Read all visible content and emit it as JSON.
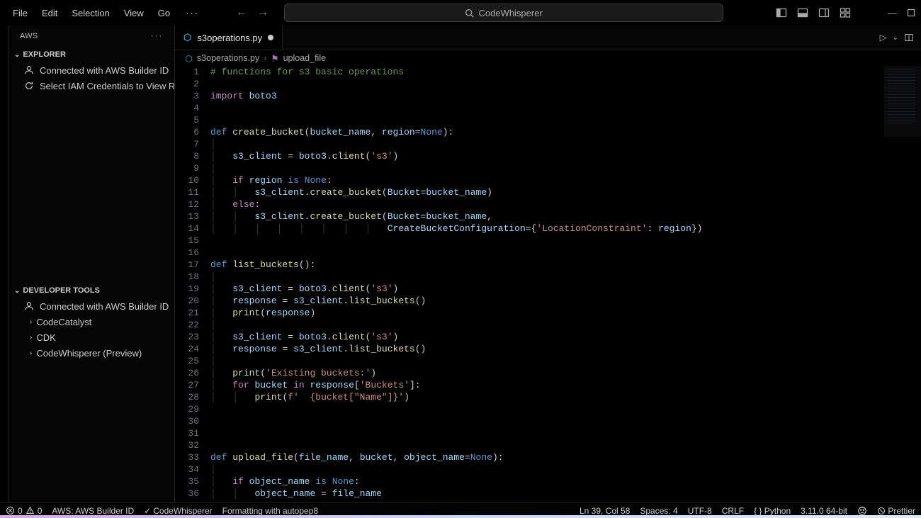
{
  "menu": {
    "items": [
      "File",
      "Edit",
      "Selection",
      "View",
      "Go"
    ],
    "overflow": "···"
  },
  "search": {
    "text": "CodeWhisperer"
  },
  "sidebar": {
    "title": "AWS",
    "explorer": {
      "header": "EXPLORER",
      "items": [
        {
          "label": "Connected with AWS Builder ID",
          "icon": "user"
        },
        {
          "label": "Select IAM Credentials to View Reso…",
          "icon": "refresh"
        }
      ]
    },
    "devtools": {
      "header": "DEVELOPER TOOLS",
      "connected": {
        "label": "Connected with AWS Builder ID",
        "icon": "user"
      },
      "tree": [
        {
          "label": "CodeCatalyst"
        },
        {
          "label": "CDK"
        },
        {
          "label": "CodeWhisperer (Preview)"
        }
      ]
    }
  },
  "tab": {
    "name": "s3operations.py"
  },
  "breadcrumb": {
    "file": "s3operations.py",
    "symbol": "upload_file"
  },
  "code": {
    "lines": [
      {
        "n": 1,
        "html": "<span class='c'># functions for s3 basic operations</span>"
      },
      {
        "n": 2,
        "html": ""
      },
      {
        "n": 3,
        "html": "<span class='k'>import</span> <span class='v'>boto3</span>"
      },
      {
        "n": 4,
        "html": ""
      },
      {
        "n": 5,
        "html": ""
      },
      {
        "n": 6,
        "html": "<span class='kb'>def</span> <span class='fn'>create_bucket</span>(<span class='v'>bucket_name</span>, <span class='v'>region</span><span class='op'>=</span><span class='kb'>None</span>):"
      },
      {
        "n": 7,
        "html": "<span class='ig'>│</span>"
      },
      {
        "n": 8,
        "html": "<span class='ig'>│</span>   <span class='v'>s3_client</span> <span class='op'>=</span> <span class='v'>boto3</span>.<span class='fn'>client</span>(<span class='s'>'s3'</span>)"
      },
      {
        "n": 9,
        "html": "<span class='ig'>│</span>"
      },
      {
        "n": 10,
        "html": "<span class='ig'>│</span>   <span class='k'>if</span> <span class='v'>region</span> <span class='kb'>is</span> <span class='kb'>None</span>:"
      },
      {
        "n": 11,
        "html": "<span class='ig'>│</span>   <span class='ig'>│</span>   <span class='v'>s3_client</span>.<span class='fn'>create_bucket</span>(<span class='v'>Bucket</span><span class='op'>=</span><span class='v'>bucket_name</span>)"
      },
      {
        "n": 12,
        "html": "<span class='ig'>│</span>   <span class='k'>else</span>:"
      },
      {
        "n": 13,
        "html": "<span class='ig'>│</span>   <span class='ig'>│</span>   <span class='v'>s3_client</span>.<span class='fn'>create_bucket</span>(<span class='v'>Bucket</span><span class='op'>=</span><span class='v'>bucket_name</span>,"
      },
      {
        "n": 14,
        "html": "<span class='ig'>│</span>   <span class='ig'>│</span>   <span class='ig'>│</span>   <span class='ig'>│</span>   <span class='ig'>│</span>   <span class='ig'>│</span>   <span class='ig'>│</span>   <span class='ig'>│</span>   <span class='v'>CreateBucketConfiguration</span><span class='op'>=</span>{<span class='s'>'LocationConstraint'</span>: <span class='v'>region</span>})"
      },
      {
        "n": 15,
        "html": ""
      },
      {
        "n": 16,
        "html": ""
      },
      {
        "n": 17,
        "html": "<span class='kb'>def</span> <span class='fn'>list_buckets</span>():"
      },
      {
        "n": 18,
        "html": "<span class='ig'>│</span>"
      },
      {
        "n": 19,
        "html": "<span class='ig'>│</span>   <span class='v'>s3_client</span> <span class='op'>=</span> <span class='v'>boto3</span>.<span class='fn'>client</span>(<span class='s'>'s3'</span>)"
      },
      {
        "n": 20,
        "html": "<span class='ig'>│</span>   <span class='v'>response</span> <span class='op'>=</span> <span class='v'>s3_client</span>.<span class='fn'>list_buckets</span>()"
      },
      {
        "n": 21,
        "html": "<span class='ig'>│</span>   <span class='fn'>print</span>(<span class='v'>response</span>)"
      },
      {
        "n": 22,
        "html": "<span class='ig'>│</span>"
      },
      {
        "n": 23,
        "html": "<span class='ig'>│</span>   <span class='v'>s3_client</span> <span class='op'>=</span> <span class='v'>boto3</span>.<span class='fn'>client</span>(<span class='s'>'s3'</span>)"
      },
      {
        "n": 24,
        "html": "<span class='ig'>│</span>   <span class='v'>response</span> <span class='op'>=</span> <span class='v'>s3_client</span>.<span class='fn'>list_buckets</span>()"
      },
      {
        "n": 25,
        "html": "<span class='ig'>│</span>"
      },
      {
        "n": 26,
        "html": "<span class='ig'>│</span>   <span class='fn'>print</span>(<span class='s'>'Existing buckets:'</span>)"
      },
      {
        "n": 27,
        "html": "<span class='ig'>│</span>   <span class='k'>for</span> <span class='v'>bucket</span> <span class='k'>in</span> <span class='v'>response</span>[<span class='s'>'Buckets'</span>]:"
      },
      {
        "n": 28,
        "html": "<span class='ig'>│</span>   <span class='ig'>│</span>   <span class='fn'>print</span>(<span class='s'>f'  {bucket[\"Name\"]}'</span>)"
      },
      {
        "n": 29,
        "html": ""
      },
      {
        "n": 30,
        "html": ""
      },
      {
        "n": 31,
        "html": ""
      },
      {
        "n": 32,
        "html": ""
      },
      {
        "n": 33,
        "html": "<span class='kb'>def</span> <span class='fn'>upload_file</span>(<span class='v'>file_name</span>, <span class='v'>bucket</span>, <span class='v'>object_name</span><span class='op'>=</span><span class='kb'>None</span>):"
      },
      {
        "n": 34,
        "html": "<span class='ig'>│</span>"
      },
      {
        "n": 35,
        "html": "<span class='ig'>│</span>   <span class='k'>if</span> <span class='v'>object_name</span> <span class='kb'>is</span> <span class='kb'>None</span>:"
      },
      {
        "n": 36,
        "html": "<span class='ig'>│</span>   <span class='ig'>│</span>   <span class='v'>object_name</span> <span class='op'>=</span> <span class='v'>file_name</span>"
      }
    ]
  },
  "status": {
    "errors": "0",
    "warnings": "0",
    "aws": "AWS: AWS Builder ID",
    "cw": "CodeWhisperer",
    "formatting": "Formatting with autopep8",
    "ln": "Ln 39, Col 58",
    "spaces": "Spaces: 4",
    "encoding": "UTF-8",
    "eol": "CRLF",
    "lang": "Python",
    "interp": "3.11.0 64-bit",
    "prettier": "Prettier"
  }
}
